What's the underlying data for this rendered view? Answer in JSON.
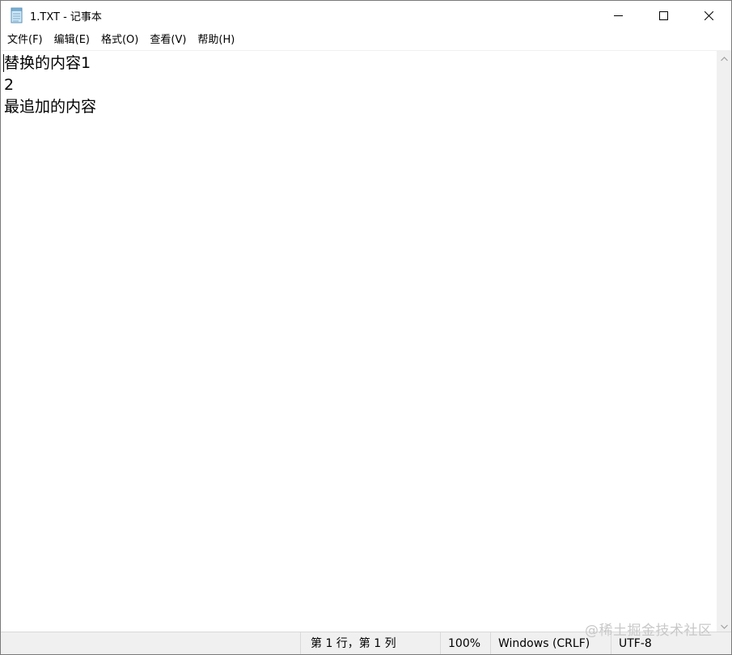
{
  "window": {
    "title": "1.TXT - 记事本"
  },
  "icons": {
    "app": "notepad-icon",
    "minimize": "minimize-icon",
    "maximize": "maximize-icon",
    "close": "close-icon",
    "scroll_up": "scroll-up-arrow-icon",
    "scroll_down": "scroll-down-arrow-icon"
  },
  "menu": {
    "items": [
      {
        "label": "文件(F)"
      },
      {
        "label": "编辑(E)"
      },
      {
        "label": "格式(O)"
      },
      {
        "label": "查看(V)"
      },
      {
        "label": "帮助(H)"
      }
    ]
  },
  "editor": {
    "lines": [
      "替换的内容1",
      "2",
      "最追加的内容"
    ]
  },
  "status": {
    "position": "第 1 行，第 1 列",
    "zoom": "100%",
    "line_ending": "Windows (CRLF)",
    "encoding": "UTF-8"
  },
  "watermark": "@稀土掘金技术社区",
  "colors": {
    "window_bg": "#ffffff",
    "statusbar_bg": "#f0f0f0",
    "scrollbar_bg": "#f0f0f0",
    "text": "#000000"
  }
}
